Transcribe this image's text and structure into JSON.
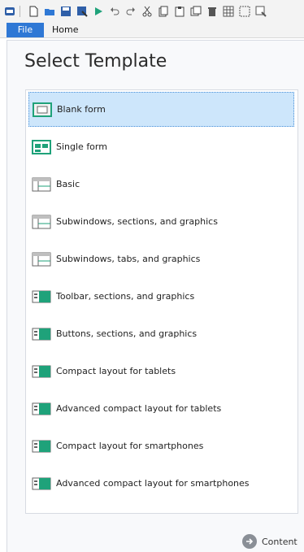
{
  "toolbar": {
    "icons": [
      "app-icon",
      "new-icon",
      "open-icon",
      "save-icon",
      "save-as-icon",
      "run-icon",
      "undo-icon",
      "redo-icon",
      "cut-icon",
      "copy-icon",
      "paste-icon",
      "duplicate-icon",
      "delete-icon",
      "grid-icon",
      "select-icon",
      "zoom-icon"
    ]
  },
  "ribbon": {
    "file_label": "File",
    "home_label": "Home"
  },
  "main": {
    "title": "Select Template",
    "templates": [
      {
        "label": "Blank form",
        "icon": "blank-form-icon",
        "selected": true
      },
      {
        "label": "Single form",
        "icon": "single-form-icon"
      },
      {
        "label": "Basic",
        "icon": "basic-layout-icon"
      },
      {
        "label": "Subwindows, sections, and graphics",
        "icon": "subwindows-sections-icon"
      },
      {
        "label": "Subwindows, tabs, and graphics",
        "icon": "subwindows-tabs-icon"
      },
      {
        "label": "Toolbar, sections, and graphics",
        "icon": "toolbar-sections-icon"
      },
      {
        "label": "Buttons, sections, and graphics",
        "icon": "buttons-sections-icon"
      },
      {
        "label": "Compact layout for tablets",
        "icon": "compact-tablet-icon"
      },
      {
        "label": "Advanced compact layout for tablets",
        "icon": "advanced-compact-tablet-icon"
      },
      {
        "label": "Compact layout for smartphones",
        "icon": "compact-smartphone-icon"
      },
      {
        "label": "Advanced compact layout for smartphones",
        "icon": "advanced-compact-smartphone-icon"
      }
    ]
  },
  "footer": {
    "content_label": "Content"
  },
  "colors": {
    "accent": "#2f78d5",
    "selection": "#cde6fb",
    "icon_green": "#1fa27a"
  }
}
